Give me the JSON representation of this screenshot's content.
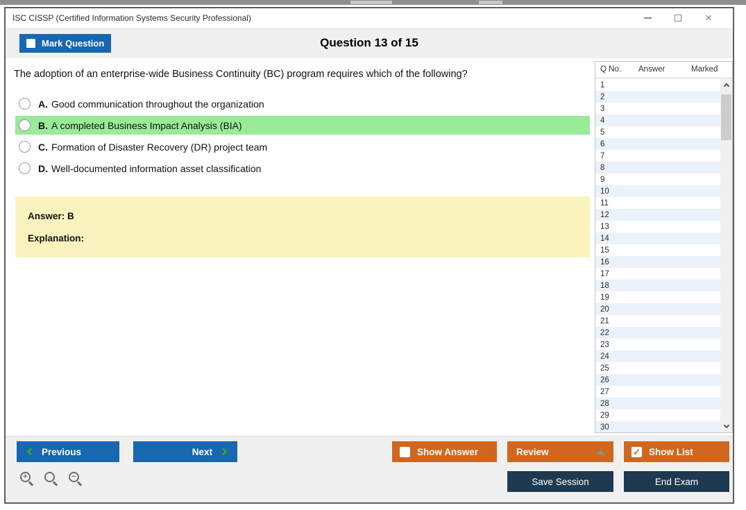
{
  "window": {
    "title": "ISC CISSP (Certified Information Systems Security Professional)"
  },
  "header": {
    "mark_question_label": "Mark Question",
    "question_counter": "Question 13 of 15"
  },
  "question": {
    "text": "The adoption of an enterprise-wide Business Continuity (BC) program requires which of the following?",
    "options": [
      {
        "letter": "A.",
        "text": "Good communication throughout the organization",
        "highlighted": false
      },
      {
        "letter": "B.",
        "text": "A completed Business Impact Analysis (BIA)",
        "highlighted": true
      },
      {
        "letter": "C.",
        "text": "Formation of Disaster Recovery (DR) project team",
        "highlighted": false
      },
      {
        "letter": "D.",
        "text": "Well-documented information asset classification",
        "highlighted": false
      }
    ],
    "answer_label": "Answer: B",
    "explanation_label": "Explanation:"
  },
  "question_list": {
    "columns": [
      "Q No.",
      "Answer",
      "Marked"
    ],
    "rows": [
      "1",
      "2",
      "3",
      "4",
      "5",
      "6",
      "7",
      "8",
      "9",
      "10",
      "11",
      "12",
      "13",
      "14",
      "15",
      "16",
      "17",
      "18",
      "19",
      "20",
      "21",
      "22",
      "23",
      "24",
      "25",
      "26",
      "27",
      "28",
      "29",
      "30"
    ]
  },
  "footer": {
    "previous_label": "Previous",
    "next_label": "Next",
    "show_answer_label": "Show Answer",
    "review_label": "Review",
    "show_list_label": "Show List",
    "save_session_label": "Save Session",
    "end_exam_label": "End Exam",
    "show_answer_checked": false,
    "show_list_checked": true
  },
  "glyphs": {
    "close": "×",
    "check": "✓"
  },
  "colors": {
    "accent_blue": "#1767b1",
    "accent_orange": "#d0671e",
    "accent_navy": "#1e3a50",
    "highlight_green": "#99eb99",
    "answer_yellow": "#faf3be",
    "row_alt_blue": "#ebf2f9"
  }
}
